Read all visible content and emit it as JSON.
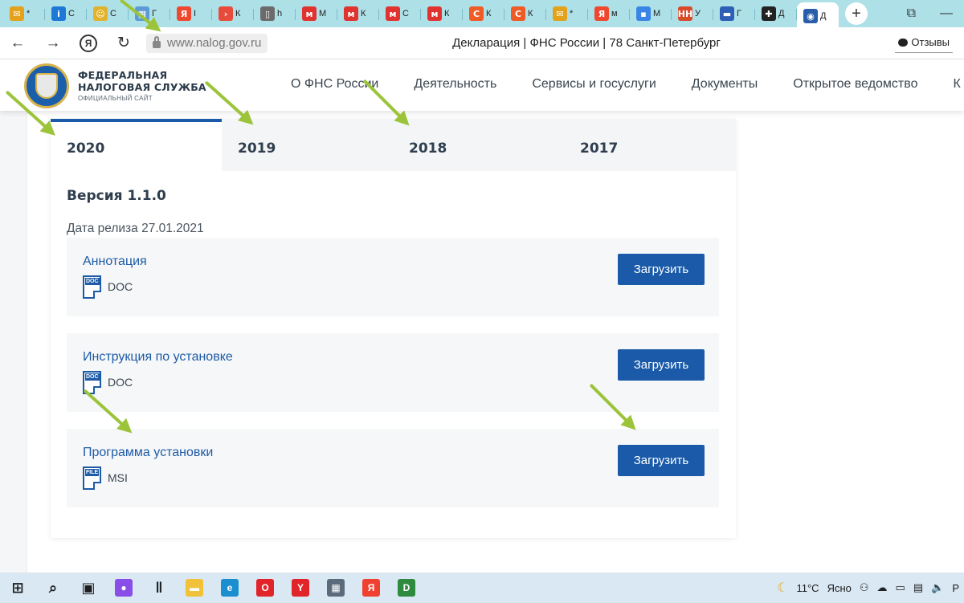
{
  "browser": {
    "tabs": [
      {
        "icon": "mail-icon",
        "glyph": "✉",
        "color": "#e3a21a",
        "text": "*"
      },
      {
        "icon": "info-icon",
        "glyph": "i",
        "color": "#1e78d6",
        "text": "С"
      },
      {
        "icon": "smile-icon",
        "glyph": "☺",
        "color": "#e2b22c",
        "text": "С"
      },
      {
        "icon": "grid-icon",
        "glyph": "▦",
        "color": "#5b9bd5",
        "text": "Г"
      },
      {
        "icon": "yandex-icon",
        "glyph": "Я",
        "color": "#f0482f",
        "text": "I"
      },
      {
        "icon": "arrow-icon",
        "glyph": "›",
        "color": "#e84b3a",
        "text": "К"
      },
      {
        "icon": "page-icon",
        "glyph": "▯",
        "color": "#6b6b6b",
        "text": "h"
      },
      {
        "icon": "m-icon",
        "glyph": "м",
        "color": "#e0332f",
        "text": "М"
      },
      {
        "icon": "m-icon",
        "glyph": "м",
        "color": "#e0332f",
        "text": "К"
      },
      {
        "icon": "m-icon",
        "glyph": "м",
        "color": "#e0332f",
        "text": "С"
      },
      {
        "icon": "m-icon",
        "glyph": "м",
        "color": "#e0332f",
        "text": "К"
      },
      {
        "icon": "c-icon",
        "glyph": "С",
        "color": "#f05a24",
        "text": "К"
      },
      {
        "icon": "c-icon",
        "glyph": "С",
        "color": "#f05a24",
        "text": "К"
      },
      {
        "icon": "mail-icon",
        "glyph": "✉",
        "color": "#e3a21a",
        "text": "*"
      },
      {
        "icon": "yandex-icon",
        "glyph": "Я",
        "color": "#f0482f",
        "text": "м"
      },
      {
        "icon": "chat-icon",
        "glyph": "▪",
        "color": "#3a86e6",
        "text": "М"
      },
      {
        "icon": "hh-icon",
        "glyph": "НН",
        "color": "#d94a2a",
        "text": "У"
      },
      {
        "icon": "flag-icon",
        "glyph": "▬",
        "color": "#2c5fb5",
        "text": "Г"
      },
      {
        "icon": "plus-circle-icon",
        "glyph": "✚",
        "color": "#222222",
        "text": "Д"
      }
    ],
    "active_tab": {
      "icon": "fns-icon",
      "glyph": "◉",
      "color": "#2a5ea8",
      "text": "Д"
    },
    "new_tab": "+",
    "url": "www.nalog.gov.ru",
    "page_title": "Декларация | ФНС России | 78 Санкт-Петербург",
    "feedback": "Отзывы"
  },
  "site": {
    "brand_line1": "ФЕДЕРАЛЬНАЯ",
    "brand_line2": "НАЛОГОВАЯ СЛУЖБА",
    "brand_sub": "ОФИЦИАЛЬНЫЙ САЙТ",
    "nav": [
      "О ФНС России",
      "Деятельность",
      "Сервисы и госуслуги",
      "Документы",
      "Открытое ведомство",
      "К"
    ]
  },
  "years": [
    "2020",
    "2019",
    "2018",
    "2017"
  ],
  "active_year": "2020",
  "version": "Версия 1.1.0",
  "release": "Дата релиза 27.01.2021",
  "files": [
    {
      "name": "Аннотация",
      "tag": "DOC",
      "ext": "DOC",
      "button": "Загрузить"
    },
    {
      "name": "Инструкция по установке",
      "tag": "DOC",
      "ext": "DOC",
      "button": "Загрузить"
    },
    {
      "name": "Программа установки",
      "tag": "FILE",
      "ext": "MSI",
      "button": "Загрузить"
    }
  ],
  "taskbar": {
    "apps": [
      {
        "icon": "windows-start-icon",
        "glyph": "⊞",
        "color": "#1e1e1e"
      },
      {
        "icon": "search-icon",
        "glyph": "⌕",
        "color": "#1e1e1e"
      },
      {
        "icon": "task-view-icon",
        "glyph": "▣",
        "color": "#1e1e1e"
      },
      {
        "icon": "alice-icon",
        "glyph": "●",
        "color": "#8a4ee8"
      },
      {
        "icon": "divider-icon",
        "glyph": "‖",
        "color": "#1e1e1e"
      },
      {
        "icon": "folder-icon",
        "glyph": "▬",
        "color": "#f2c13a"
      },
      {
        "icon": "edge-icon",
        "glyph": "e",
        "color": "#1a8fd0"
      },
      {
        "icon": "opera-icon",
        "glyph": "O",
        "color": "#e0242a"
      },
      {
        "icon": "yandex-browser-icon",
        "glyph": "Y",
        "color": "#e0242a"
      },
      {
        "icon": "calculator-icon",
        "glyph": "▦",
        "color": "#5b6b7b"
      },
      {
        "icon": "yandex-icon",
        "glyph": "Я",
        "color": "#f0402f"
      },
      {
        "icon": "declaration-icon",
        "glyph": "D",
        "color": "#2e8a3e"
      }
    ],
    "weather_temp": "11°C",
    "weather_text": "Ясно",
    "lang": "Р"
  }
}
